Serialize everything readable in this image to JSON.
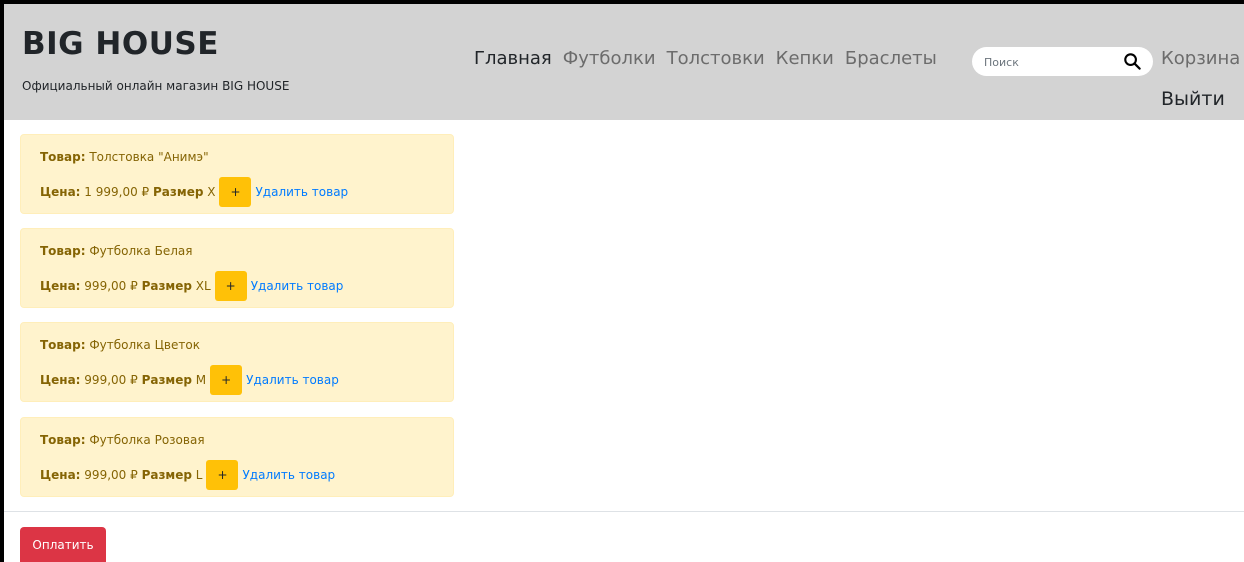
{
  "header": {
    "brand_title": "BIG HOUSE",
    "brand_subtitle": "Официальный онлайн магазин BIG HOUSE",
    "nav": [
      {
        "label": "Главная",
        "active": true
      },
      {
        "label": "Футболки",
        "active": false
      },
      {
        "label": "Толстовки",
        "active": false
      },
      {
        "label": "Кепки",
        "active": false
      },
      {
        "label": "Браслеты",
        "active": false
      }
    ],
    "search": {
      "placeholder": "Поиск",
      "value": "",
      "icon": "search-icon"
    },
    "cart_label": "Корзина",
    "logout_label": "Выйти"
  },
  "labels": {
    "product": "Товар:",
    "price": "Цена:",
    "size": "Размер",
    "plus": "+",
    "remove": "Удалить товар"
  },
  "cart": {
    "items": [
      {
        "name": "Толстовка \"Анимэ\"",
        "price": "1 999,00 ₽",
        "size": "X"
      },
      {
        "name": "Футболка Белая",
        "price": "999,00 ₽",
        "size": "XL"
      },
      {
        "name": "Футболка Цветок",
        "price": "999,00 ₽",
        "size": "M"
      },
      {
        "name": "Футболка Розовая",
        "price": "999,00 ₽",
        "size": "L"
      }
    ]
  },
  "pay_button": "Оплатить",
  "colors": {
    "header_bg": "#d3d3d3",
    "item_bg": "#fff3cd",
    "item_text": "#856404",
    "plus_button": "#ffc107",
    "link": "#007bff",
    "pay_button": "#dc3545"
  }
}
